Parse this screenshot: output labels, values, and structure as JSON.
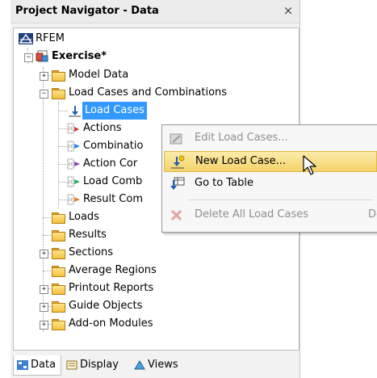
{
  "panel": {
    "title": "Project Navigator - Data",
    "close_glyph": "×"
  },
  "tree": {
    "root_label": "RFEM",
    "project_label": "Exercise*",
    "items": [
      {
        "label": "Model Data",
        "expander": "+"
      },
      {
        "label": "Load Cases and Combinations",
        "expander": "−"
      },
      {
        "label": "Load Cases",
        "selected": true
      },
      {
        "label": "Actions"
      },
      {
        "label": "Combinations"
      },
      {
        "label": "Action Combinations"
      },
      {
        "label": "Load Combinations"
      },
      {
        "label": "Result Combinations"
      },
      {
        "label": "Loads"
      },
      {
        "label": "Results"
      },
      {
        "label": "Sections",
        "expander": "+"
      },
      {
        "label": "Average Regions"
      },
      {
        "label": "Printout Reports",
        "expander": "+"
      },
      {
        "label": "Guide Objects",
        "expander": "+"
      },
      {
        "label": "Add-on Modules",
        "expander": "+"
      }
    ],
    "visible_labels": {
      "combinations": "Combinatio",
      "action_combinations": "Action Cor",
      "load_combinations": "Load Comb",
      "result_combinations": "Result Com"
    }
  },
  "tabs": [
    {
      "label": "Data",
      "active": true,
      "icon": "data-tab-icon"
    },
    {
      "label": "Display",
      "active": false,
      "icon": "display-tab-icon"
    },
    {
      "label": "Views",
      "active": false,
      "icon": "views-tab-icon"
    }
  ],
  "context_menu": {
    "items": [
      {
        "label": "Edit Load Cases...",
        "disabled": true,
        "icon": "edit-load-cases-icon",
        "shortcut": ""
      },
      {
        "label": "New Load Case...",
        "disabled": false,
        "hover": true,
        "icon": "new-load-case-icon",
        "shortcut": ""
      },
      {
        "label": "Go to Table",
        "disabled": false,
        "icon": "go-to-table-icon",
        "shortcut": ""
      },
      {
        "label": "Delete All Load Cases",
        "disabled": true,
        "icon": "delete-icon",
        "shortcut": "Del"
      }
    ]
  },
  "colors": {
    "selection": "#3399ff",
    "menu_hover": "#f4d36a",
    "folder": "#f3c13d"
  }
}
